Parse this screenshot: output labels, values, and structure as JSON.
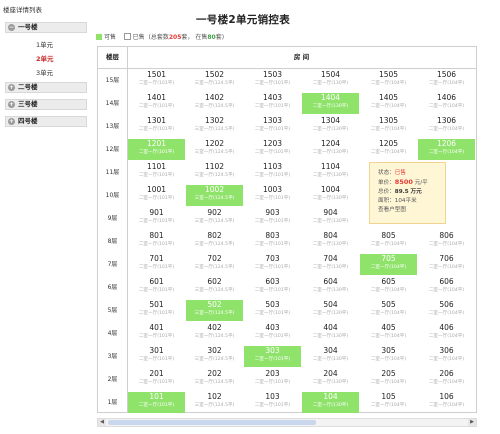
{
  "sidebar": {
    "title": "楼座详情列表",
    "buildings": [
      {
        "label": "一号楼",
        "icon": "minus-icon",
        "expanded": true
      },
      {
        "label": "二号楼",
        "icon": "plus-icon",
        "expanded": false
      },
      {
        "label": "三号楼",
        "icon": "plus-icon",
        "expanded": false
      },
      {
        "label": "四号楼",
        "icon": "plus-icon",
        "expanded": false
      }
    ],
    "units": [
      "1单元",
      "2单元",
      "3单元"
    ],
    "selected_unit": "2单元"
  },
  "title": "一号楼2单元销控表",
  "legend": {
    "available_label": "可售",
    "sold_label": "已售",
    "total_prefix": "(总套数",
    "total_value": "205",
    "total_suffix": "套，",
    "remaining_prefix": "在售",
    "remaining_value": "80",
    "remaining_suffix": "套)"
  },
  "grid": {
    "floor_header": "楼层",
    "room_header": "房 间",
    "floors": [
      {
        "label": "15层",
        "rooms": [
          {
            "no": "1501",
            "type": "二室一厅(101平)",
            "sold": false
          },
          {
            "no": "1502",
            "type": "三室一厅(124.5平)",
            "sold": false
          },
          {
            "no": "1503",
            "type": "二室一厅(101平)",
            "sold": false
          },
          {
            "no": "1504",
            "type": "二室一厅(130平)",
            "sold": false
          },
          {
            "no": "1505",
            "type": "二室一厅(104平)",
            "sold": false
          },
          {
            "no": "1506",
            "type": "二室一厅(104平)",
            "sold": false
          }
        ]
      },
      {
        "label": "14层",
        "rooms": [
          {
            "no": "1401",
            "type": "二室一厅(101平)",
            "sold": false
          },
          {
            "no": "1402",
            "type": "三室一厅(124.5平)",
            "sold": false
          },
          {
            "no": "1403",
            "type": "二室一厅(101平)",
            "sold": false
          },
          {
            "no": "1404",
            "type": "二室一厅(130平)",
            "sold": true
          },
          {
            "no": "1405",
            "type": "二室一厅(104平)",
            "sold": false
          },
          {
            "no": "1406",
            "type": "二室一厅(104平)",
            "sold": false
          }
        ]
      },
      {
        "label": "13层",
        "rooms": [
          {
            "no": "1301",
            "type": "二室一厅(101平)",
            "sold": false
          },
          {
            "no": "1302",
            "type": "三室一厅(124.5平)",
            "sold": false
          },
          {
            "no": "1303",
            "type": "二室一厅(101平)",
            "sold": false
          },
          {
            "no": "1304",
            "type": "二室一厅(130平)",
            "sold": false
          },
          {
            "no": "1305",
            "type": "二室一厅(104平)",
            "sold": false
          },
          {
            "no": "1306",
            "type": "二室一厅(104平)",
            "sold": false
          }
        ]
      },
      {
        "label": "12层",
        "rooms": [
          {
            "no": "1201",
            "type": "二室一厅(101平)",
            "sold": true
          },
          {
            "no": "1202",
            "type": "三室一厅(124.5平)",
            "sold": false
          },
          {
            "no": "1203",
            "type": "二室一厅(101平)",
            "sold": false
          },
          {
            "no": "1204",
            "type": "二室一厅(130平)",
            "sold": false
          },
          {
            "no": "1205",
            "type": "二室一厅(104平)",
            "sold": false
          },
          {
            "no": "1206",
            "type": "二室一厅(104平)",
            "sold": true
          }
        ]
      },
      {
        "label": "11层",
        "rooms": [
          {
            "no": "1101",
            "type": "二室一厅(101平)",
            "sold": false
          },
          {
            "no": "1102",
            "type": "三室一厅(124.5平)",
            "sold": false
          },
          {
            "no": "1103",
            "type": "二室一厅(101平)",
            "sold": false
          },
          {
            "no": "1104",
            "type": "二室一厅(130平)",
            "sold": false
          },
          {
            "no": "",
            "type": "",
            "sold": false
          },
          {
            "no": "",
            "type": "",
            "sold": false
          }
        ]
      },
      {
        "label": "10层",
        "rooms": [
          {
            "no": "1001",
            "type": "二室一厅(101平)",
            "sold": false
          },
          {
            "no": "1002",
            "type": "三室一厅(124.5平)",
            "sold": true
          },
          {
            "no": "1003",
            "type": "二室一厅(101平)",
            "sold": false
          },
          {
            "no": "1004",
            "type": "二室一厅(130平)",
            "sold": false
          },
          {
            "no": "",
            "type": "",
            "sold": false
          },
          {
            "no": "",
            "type": "",
            "sold": false
          }
        ]
      },
      {
        "label": "9层",
        "rooms": [
          {
            "no": "901",
            "type": "二室一厅(101平)",
            "sold": false
          },
          {
            "no": "902",
            "type": "三室一厅(124.5平)",
            "sold": false
          },
          {
            "no": "903",
            "type": "二室一厅(101平)",
            "sold": false
          },
          {
            "no": "904",
            "type": "二室一厅(130平)",
            "sold": false
          },
          {
            "no": "",
            "type": "",
            "sold": false
          },
          {
            "no": "",
            "type": "",
            "sold": false
          }
        ]
      },
      {
        "label": "8层",
        "rooms": [
          {
            "no": "801",
            "type": "二室一厅(101平)",
            "sold": false
          },
          {
            "no": "802",
            "type": "三室一厅(124.5平)",
            "sold": false
          },
          {
            "no": "803",
            "type": "二室一厅(101平)",
            "sold": false
          },
          {
            "no": "804",
            "type": "二室一厅(130平)",
            "sold": false
          },
          {
            "no": "805",
            "type": "二室一厅(104平)",
            "sold": false
          },
          {
            "no": "806",
            "type": "二室一厅(104平)",
            "sold": false
          }
        ]
      },
      {
        "label": "7层",
        "rooms": [
          {
            "no": "701",
            "type": "二室一厅(101平)",
            "sold": false
          },
          {
            "no": "702",
            "type": "三室一厅(124.5平)",
            "sold": false
          },
          {
            "no": "703",
            "type": "二室一厅(101平)",
            "sold": false
          },
          {
            "no": "704",
            "type": "二室一厅(130平)",
            "sold": false
          },
          {
            "no": "705",
            "type": "二室一厅(104平)",
            "sold": true
          },
          {
            "no": "706",
            "type": "二室一厅(104平)",
            "sold": false
          }
        ]
      },
      {
        "label": "6层",
        "rooms": [
          {
            "no": "601",
            "type": "二室一厅(101平)",
            "sold": false
          },
          {
            "no": "602",
            "type": "三室一厅(124.5平)",
            "sold": false
          },
          {
            "no": "603",
            "type": "二室一厅(101平)",
            "sold": false
          },
          {
            "no": "604",
            "type": "二室一厅(130平)",
            "sold": false
          },
          {
            "no": "605",
            "type": "二室一厅(104平)",
            "sold": false
          },
          {
            "no": "606",
            "type": "二室一厅(104平)",
            "sold": false
          }
        ]
      },
      {
        "label": "5层",
        "rooms": [
          {
            "no": "501",
            "type": "二室一厅(101平)",
            "sold": false
          },
          {
            "no": "502",
            "type": "三室一厅(124.5平)",
            "sold": true
          },
          {
            "no": "503",
            "type": "二室一厅(101平)",
            "sold": false
          },
          {
            "no": "504",
            "type": "二室一厅(130平)",
            "sold": false
          },
          {
            "no": "505",
            "type": "二室一厅(104平)",
            "sold": false
          },
          {
            "no": "506",
            "type": "二室一厅(104平)",
            "sold": false
          }
        ]
      },
      {
        "label": "4层",
        "rooms": [
          {
            "no": "401",
            "type": "二室一厅(101平)",
            "sold": false
          },
          {
            "no": "402",
            "type": "三室一厅(124.5平)",
            "sold": false
          },
          {
            "no": "403",
            "type": "二室一厅(101平)",
            "sold": false
          },
          {
            "no": "404",
            "type": "二室一厅(130平)",
            "sold": false
          },
          {
            "no": "405",
            "type": "二室一厅(104平)",
            "sold": false
          },
          {
            "no": "406",
            "type": "二室一厅(104平)",
            "sold": false
          }
        ]
      },
      {
        "label": "3层",
        "rooms": [
          {
            "no": "301",
            "type": "二室一厅(101平)",
            "sold": false
          },
          {
            "no": "302",
            "type": "三室一厅(124.5平)",
            "sold": false
          },
          {
            "no": "303",
            "type": "二室一厅(101平)",
            "sold": true
          },
          {
            "no": "304",
            "type": "二室一厅(130平)",
            "sold": false
          },
          {
            "no": "305",
            "type": "二室一厅(104平)",
            "sold": false
          },
          {
            "no": "306",
            "type": "二室一厅(104平)",
            "sold": false
          }
        ]
      },
      {
        "label": "2层",
        "rooms": [
          {
            "no": "201",
            "type": "二室一厅(101平)",
            "sold": false
          },
          {
            "no": "202",
            "type": "三室一厅(124.5平)",
            "sold": false
          },
          {
            "no": "203",
            "type": "二室一厅(101平)",
            "sold": false
          },
          {
            "no": "204",
            "type": "二室一厅(130平)",
            "sold": false
          },
          {
            "no": "205",
            "type": "二室一厅(104平)",
            "sold": false
          },
          {
            "no": "206",
            "type": "二室一厅(104平)",
            "sold": false
          }
        ]
      },
      {
        "label": "1层",
        "rooms": [
          {
            "no": "101",
            "type": "二室一厅(101平)",
            "sold": true
          },
          {
            "no": "102",
            "type": "三室一厅(124.5平)",
            "sold": false
          },
          {
            "no": "103",
            "type": "二室一厅(101平)",
            "sold": false
          },
          {
            "no": "104",
            "type": "二室一厅(130平)",
            "sold": true
          },
          {
            "no": "105",
            "type": "二室一厅(104平)",
            "sold": false
          },
          {
            "no": "106",
            "type": "二室一厅(104平)",
            "sold": false
          }
        ]
      }
    ]
  },
  "tooltip": {
    "status_label": "状态：",
    "status_value": "已售",
    "price_label": "单价：",
    "price_value": "8500",
    "price_unit": "元/平",
    "total_label": "总价：",
    "total_value": "89.5 万元",
    "area_label": "面积：",
    "area_value": "104平米",
    "floorplan_link": "查看户型图"
  },
  "colors": {
    "sold": "#8fe36b",
    "accent_red": "#e53935",
    "accent_green": "#43a047"
  }
}
